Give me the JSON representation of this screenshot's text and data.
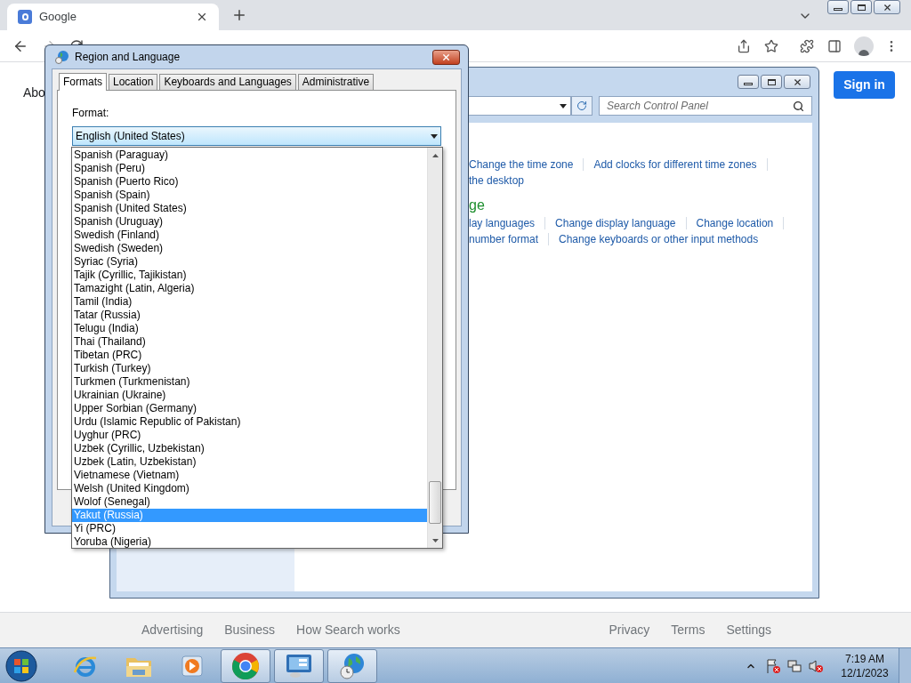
{
  "browser": {
    "tab": {
      "title": "Google"
    },
    "page": {
      "about": "Abo",
      "sign_in": "Sign in"
    },
    "footer": {
      "left": [
        "Advertising",
        "Business",
        "How Search works"
      ],
      "right": [
        "Privacy",
        "Terms",
        "Settings"
      ]
    }
  },
  "control_panel": {
    "search_placeholder": "Search Control Panel",
    "lines": [
      {
        "kind": "links",
        "items": [
          "Change the time zone",
          "Add clocks for different time zones"
        ],
        "trailing_separator": true
      },
      {
        "kind": "links",
        "items": [
          "the desktop"
        ],
        "trailing_separator": false
      },
      {
        "kind": "heading",
        "items": [
          "ge"
        ],
        "trailing_separator": false
      },
      {
        "kind": "links",
        "items": [
          "lay languages",
          "Change display language",
          "Change location"
        ],
        "trailing_separator": true
      },
      {
        "kind": "links",
        "items": [
          "number format",
          "Change keyboards or other input methods"
        ],
        "trailing_separator": false
      }
    ]
  },
  "dialog": {
    "title": "Region and Language",
    "tabs": [
      {
        "label": "Formats",
        "selected": true
      },
      {
        "label": "Location",
        "selected": false
      },
      {
        "label": "Keyboards and Languages",
        "selected": false
      },
      {
        "label": "Administrative",
        "selected": false
      }
    ],
    "format_label": "Format:",
    "format_value": "English (United States)",
    "options": [
      {
        "label": "Spanish (Paraguay)",
        "selected": false
      },
      {
        "label": "Spanish (Peru)",
        "selected": false
      },
      {
        "label": "Spanish (Puerto Rico)",
        "selected": false
      },
      {
        "label": "Spanish (Spain)",
        "selected": false
      },
      {
        "label": "Spanish (United States)",
        "selected": false
      },
      {
        "label": "Spanish (Uruguay)",
        "selected": false
      },
      {
        "label": "Swedish (Finland)",
        "selected": false
      },
      {
        "label": "Swedish (Sweden)",
        "selected": false
      },
      {
        "label": "Syriac (Syria)",
        "selected": false
      },
      {
        "label": "Tajik (Cyrillic, Tajikistan)",
        "selected": false
      },
      {
        "label": "Tamazight (Latin, Algeria)",
        "selected": false
      },
      {
        "label": "Tamil (India)",
        "selected": false
      },
      {
        "label": "Tatar (Russia)",
        "selected": false
      },
      {
        "label": "Telugu (India)",
        "selected": false
      },
      {
        "label": "Thai (Thailand)",
        "selected": false
      },
      {
        "label": "Tibetan (PRC)",
        "selected": false
      },
      {
        "label": "Turkish (Turkey)",
        "selected": false
      },
      {
        "label": "Turkmen (Turkmenistan)",
        "selected": false
      },
      {
        "label": "Ukrainian (Ukraine)",
        "selected": false
      },
      {
        "label": "Upper Sorbian (Germany)",
        "selected": false
      },
      {
        "label": "Urdu (Islamic Republic of Pakistan)",
        "selected": false
      },
      {
        "label": "Uyghur (PRC)",
        "selected": false
      },
      {
        "label": "Uzbek (Cyrillic, Uzbekistan)",
        "selected": false
      },
      {
        "label": "Uzbek (Latin, Uzbekistan)",
        "selected": false
      },
      {
        "label": "Vietnamese (Vietnam)",
        "selected": false
      },
      {
        "label": "Welsh (United Kingdom)",
        "selected": false
      },
      {
        "label": "Wolof (Senegal)",
        "selected": false
      },
      {
        "label": "Yakut (Russia)",
        "selected": true
      },
      {
        "label": "Yi (PRC)",
        "selected": false
      },
      {
        "label": "Yoruba (Nigeria)",
        "selected": false
      }
    ]
  },
  "taskbar": {
    "apps": [
      {
        "kind": "ie",
        "active": false
      },
      {
        "kind": "explorer",
        "active": false
      },
      {
        "kind": "media",
        "active": false
      },
      {
        "kind": "chrome",
        "active": true
      },
      {
        "kind": "control",
        "active": true
      },
      {
        "kind": "region",
        "active": true
      }
    ],
    "clock": {
      "time": "7:19 AM",
      "date": "12/1/2023"
    }
  }
}
